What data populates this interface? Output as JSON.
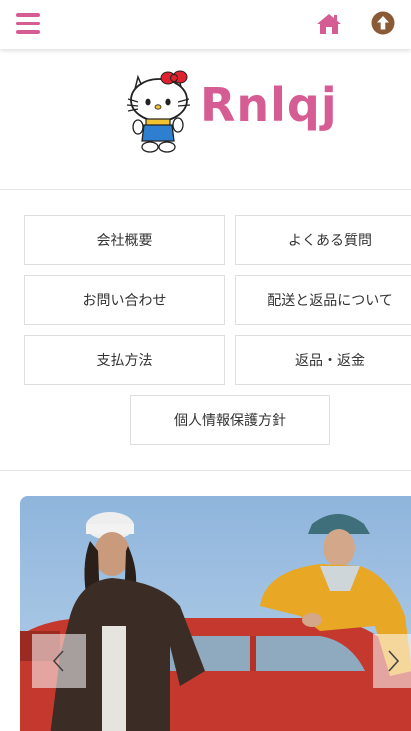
{
  "header": {
    "menu_icon": "hamburger-menu-icon",
    "home_icon": "home-icon",
    "top_icon": "arrow-up-circle-icon",
    "accent_color": "#d55d94",
    "top_icon_color": "#8a5a36"
  },
  "logo": {
    "brand_name": "Rnlqj",
    "mascot": "hello-kitty-mascot"
  },
  "nav": {
    "items": [
      {
        "label": "会社概要"
      },
      {
        "label": "よくある質問"
      },
      {
        "label": "お問い合わせ"
      },
      {
        "label": "配送と返品について"
      },
      {
        "label": "支払方法"
      },
      {
        "label": "返品・返金"
      },
      {
        "label": "個人情報保護方針"
      }
    ]
  },
  "slider": {
    "prev_icon": "chevron-left-icon",
    "next_icon": "chevron-right-icon"
  }
}
